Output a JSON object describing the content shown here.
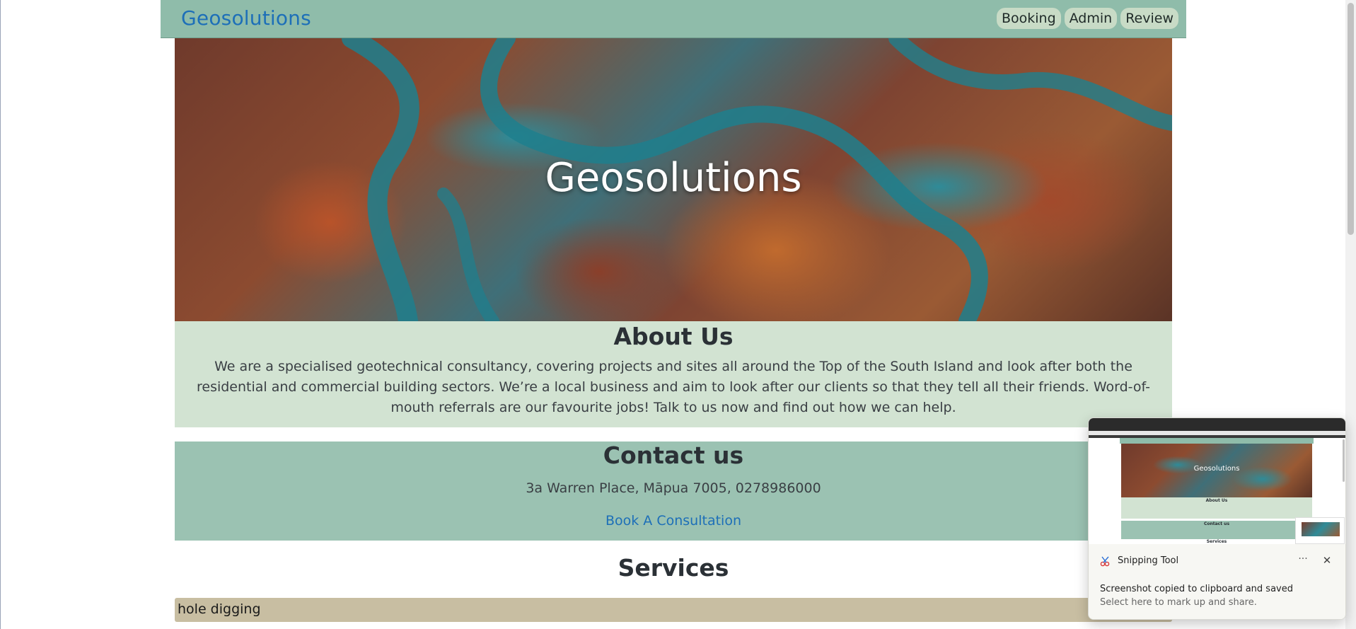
{
  "navbar": {
    "brand": "Geosolutions",
    "links": [
      "Booking",
      "Admin",
      "Review"
    ]
  },
  "hero": {
    "title": "Geosolutions"
  },
  "about": {
    "heading": "About Us",
    "text": "We are a specialised geotechnical consultancy, covering projects and sites all around the Top of the South Island and look after both the residential and commercial building sectors. We’re a local business and aim to look after our clients so that they tell all their friends. Word-of-mouth referrals are our favourite jobs! Talk to us now and find out how we can help."
  },
  "contact": {
    "heading": "Contact us",
    "address": "3a Warren Place, Māpua 7005, 0278986000",
    "book_link": "Book A Consultation"
  },
  "services": {
    "heading": "Services",
    "items": [
      "hole digging"
    ]
  },
  "toast": {
    "app_name": "Snipping Tool",
    "message": "Screenshot copied to clipboard and saved",
    "sub_message": "Select here to mark up and share.",
    "more_label": "···",
    "close_label": "✕",
    "thumb_hero_title": "Geosolutions",
    "thumb_about": "About Us",
    "thumb_contact": "Contact us",
    "thumb_services": "Services"
  },
  "colors": {
    "nav_bg": "#8fbcaa",
    "brand": "#1d6fb8",
    "about_bg": "#d2e3d2",
    "contact_bg": "#9bc2b2",
    "service_bg": "#c8bea2"
  }
}
